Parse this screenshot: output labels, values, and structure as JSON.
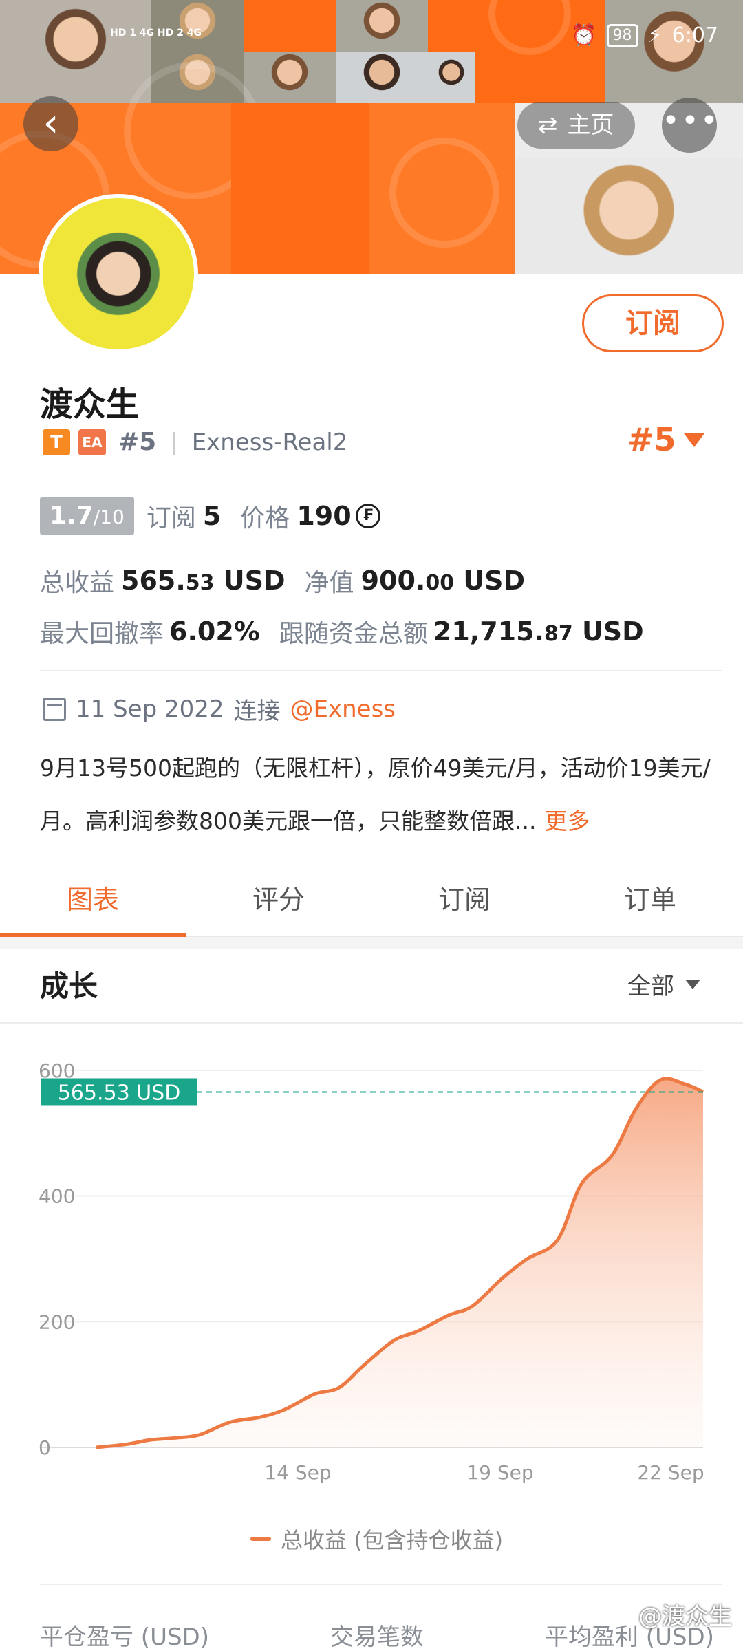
{
  "status_bar": {
    "network": "HD 1 4G  HD 2 4G",
    "battery": "98",
    "time": "6:07"
  },
  "header": {
    "back_icon": "back-chevron-icon",
    "home_label": "主页",
    "home_icon": "swap-arrows-icon",
    "more_label": "•••"
  },
  "profile": {
    "name": "渡众生",
    "subscribe_label": "订阅",
    "tag_t": "T",
    "tag_ea": "EA",
    "rank_small": "#5",
    "account": "Exness-Real2",
    "rank_big": "#5"
  },
  "stats": {
    "rating_value": "1.7",
    "rating_max": "/10",
    "subscriptions_label": "订阅",
    "subscriptions_value": "5",
    "price_label": "价格",
    "price_value": "190",
    "price_icon": "coin-icon",
    "total_profit_label": "总收益",
    "total_profit_int": "565.",
    "total_profit_dec": "53",
    "total_profit_unit": "USD",
    "equity_label": "净值",
    "equity_int": "900.",
    "equity_dec": "00",
    "equity_unit": "USD",
    "drawdown_label": "最大回撤率",
    "drawdown_value": "6.02%",
    "followers_funds_label": "跟随资金总额",
    "followers_funds_int": "21,715.",
    "followers_funds_dec": "87",
    "followers_funds_unit": "USD"
  },
  "connection": {
    "date": "11 Sep 2022",
    "connected_label": "连接",
    "broker": "@Exness"
  },
  "description": {
    "text": "9月13号500起跑的（无限杠杆），原价49美元/月，活动价19美元/月。高利润参数800美元跟一倍，只能整数倍跟...",
    "more_label": "更多"
  },
  "tabs": [
    {
      "label": "图表",
      "active": true
    },
    {
      "label": "评分",
      "active": false
    },
    {
      "label": "订阅",
      "active": false
    },
    {
      "label": "订单",
      "active": false
    }
  ],
  "section": {
    "title": "成长",
    "range_label": "全部"
  },
  "chart_data": {
    "type": "area",
    "title": "",
    "xlabel": "",
    "ylabel": "",
    "ylim": [
      0,
      600
    ],
    "yticks": [
      0,
      200,
      400,
      600
    ],
    "xtick_labels": [
      "14 Sep",
      "19 Sep",
      "22 Sep"
    ],
    "current_value_label": "565.53 USD",
    "current_value": 565.53,
    "series": [
      {
        "name": "总收益 (包含持仓收益)",
        "color": "#ee7a43",
        "values": [
          0,
          5,
          12,
          15,
          20,
          40,
          48,
          60,
          85,
          95,
          130,
          170,
          185,
          210,
          225,
          270,
          300,
          330,
          420,
          465,
          540,
          585,
          578,
          566
        ]
      }
    ],
    "x_positions": [
      0,
      0.05,
      0.09,
      0.13,
      0.17,
      0.22,
      0.27,
      0.31,
      0.36,
      0.4,
      0.44,
      0.49,
      0.53,
      0.58,
      0.62,
      0.67,
      0.71,
      0.76,
      0.8,
      0.85,
      0.89,
      0.93,
      0.97,
      1.0
    ],
    "accent_label_color": "#1aa68a"
  },
  "legend_label": "总收益 (包含持仓收益)",
  "footer_columns": [
    "平仓盈亏 (USD)",
    "交易笔数",
    "平均盈利 (USD)"
  ],
  "watermark": "@渡众生"
}
